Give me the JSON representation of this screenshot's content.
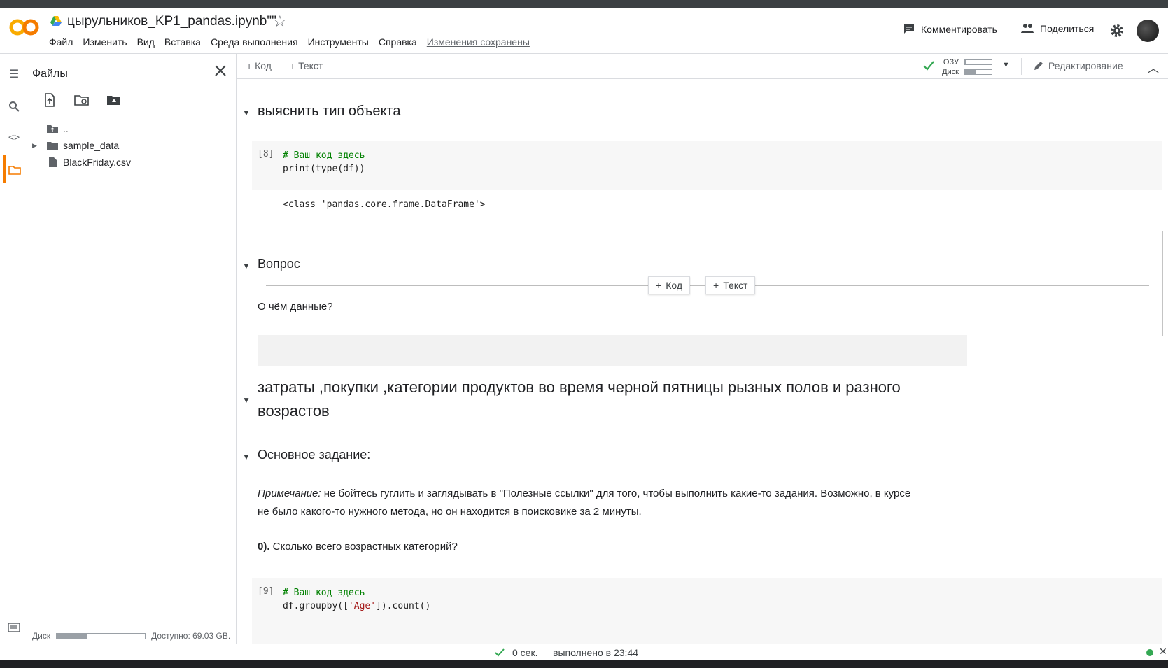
{
  "header": {
    "title": "цырульников_KP1_pandas.ipynb\"\"",
    "menu": [
      "Файл",
      "Изменить",
      "Вид",
      "Вставка",
      "Среда выполнения",
      "Инструменты",
      "Справка"
    ],
    "saved_status": "Изменения сохранены",
    "comment_label": "Комментировать",
    "share_label": "Поделиться"
  },
  "sidebar": {
    "title": "Файлы",
    "tree": [
      {
        "name": "..",
        "icon": "folder-up-icon"
      },
      {
        "name": "sample_data",
        "icon": "folder-icon",
        "expandable": true
      },
      {
        "name": "BlackFriday.csv",
        "icon": "file-icon"
      }
    ],
    "disk_label": "Диск",
    "disk_free": "Доступно: 69.03 GB.",
    "disk_fill": 0.35
  },
  "toolbar": {
    "add_code": "Код",
    "add_text": "Текст",
    "ram_label": "ОЗУ",
    "disk_label": "Диск",
    "ram_fill": 0.05,
    "disk_fill": 0.4,
    "edit_label": "Редактирование"
  },
  "notebook": {
    "heading_type": "выяснить тип объекта",
    "cell8_prompt": "[8]",
    "cell8_comment": "# Ваш код здесь",
    "cell8_code": "print(type(df))",
    "cell8_output": "<class 'pandas.core.frame.DataFrame'>",
    "heading_question": "Вопрос",
    "insert_code": "Код",
    "insert_text": "Текст",
    "question_text": "О чём данные?",
    "answer_heading_1": "затраты ,покупки ,категории продуктов во время черной пятницы рызных полов и разного",
    "answer_heading_2": "возрастов",
    "heading_main": "Основное задание:",
    "note_label": "Примечание:",
    "note_text_1": " не бойтесь гуглить и заглядывать в \"Полезные ссылки\" для того, чтобы выполнить какие-то задания. Возможно, в курсе",
    "note_text_2": "не было какого-то нужного метода, но он находится в поисковике за 2 минуты.",
    "q0_label": "0).",
    "q0_text": " Сколько всего возрастных категорий?",
    "cell9_prompt": "[9]",
    "cell9_comment": "# Ваш код здесь",
    "cell9_code_pre": "df.groupby([",
    "cell9_code_str": "'Age'",
    "cell9_code_post": "]).count()"
  },
  "status": {
    "time": "0 сек.",
    "finished": "выполнено в 23:44"
  },
  "colors": {
    "logo_orange": "#f9ab00",
    "accent_orange": "#f57c00",
    "check_green": "#34a853"
  }
}
